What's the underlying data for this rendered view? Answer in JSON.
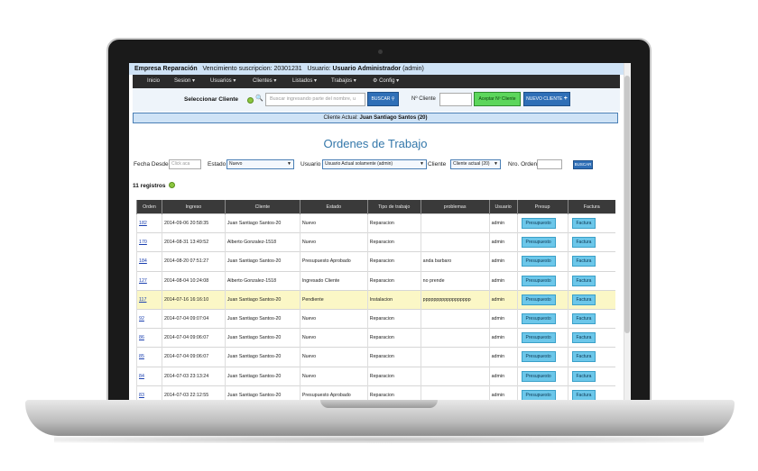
{
  "topbar": {
    "company": "Empresa Reparación",
    "expiry": "Vencimiento suscripcion: 20301231",
    "user_label": "Usuario:",
    "user": "Usuario Administrador",
    "role": "(admin)"
  },
  "nav": {
    "items": [
      {
        "label": "Inicio"
      },
      {
        "label": "Sesion"
      },
      {
        "label": "Usuarios"
      },
      {
        "label": "Clientes"
      },
      {
        "label": "Listados"
      },
      {
        "label": "Trabajos"
      },
      {
        "label": "Config"
      }
    ],
    "caret": "▾"
  },
  "client_select": {
    "label": "Seleccionar Cliente",
    "search_placeholder": "Buscar ingresando parte del nombre, u",
    "search_button": "BUSCAR",
    "ncliente_label": "Nº Cliente",
    "accept_button": "Aceptar Nº Cliente",
    "new_button": "NUEVO CLIENTE"
  },
  "current_client": {
    "label": "Cliente Actual:",
    "name": "Juan Santiago Santos (20)"
  },
  "page_title": "Ordenes de Trabajo",
  "filters": {
    "fecha_label": "Fecha Desde",
    "fecha_placeholder": "Click aca",
    "estado_label": "Estado",
    "estado_value": "Nuevo",
    "usuario_label": "Usuario",
    "usuario_value": "Usuario Actual solamente (admin)",
    "cliente_label": "Cliente",
    "cliente_value": "Cliente actual (20)",
    "nro_label": "Nro. Orden",
    "buscar_button": "BUSCAR"
  },
  "registros": "11 registros",
  "table": {
    "headers": [
      "Orden",
      "Ingreso",
      "Cliente",
      "Estado",
      "Tipo de trabajo",
      "problemas",
      "Usuario",
      "Presup",
      "Factura"
    ],
    "presup_label": "Presupuesto",
    "factura_label": "Factura",
    "rows": [
      {
        "orden": "182",
        "ingreso": "2014-09-06 20:58:35",
        "cliente": "Juan Santiago Santos-20",
        "estado": "Nuevo",
        "tipo": "Reparacion",
        "problemas": "",
        "usuario": "admin"
      },
      {
        "orden": "170",
        "ingreso": "2014-08-31 13:49:52",
        "cliente": "Alberto Gonzalez-1518",
        "estado": "Nuevo",
        "tipo": "Reparacion",
        "problemas": "",
        "usuario": "admin"
      },
      {
        "orden": "184",
        "ingreso": "2014-08-20 07:51:27",
        "cliente": "Juan Santiago Santos-20",
        "estado": "Presupuesto Aprobado",
        "tipo": "Reparacion",
        "problemas": "anda barbaro",
        "usuario": "admin"
      },
      {
        "orden": "127",
        "ingreso": "2014-08-04 10:24:08",
        "cliente": "Alberto Gonzalez-1518",
        "estado": "Ingresado Cliente",
        "tipo": "Reparacion",
        "problemas": "no prende",
        "usuario": "admin"
      },
      {
        "orden": "117",
        "ingreso": "2014-07-16 16:16:10",
        "cliente": "Juan Santiago Santos-20",
        "estado": "Pendiente",
        "tipo": "Instalacion",
        "problemas": "pppppppppppppppppp",
        "usuario": "admin"
      },
      {
        "orden": "92",
        "ingreso": "2014-07-04 09:07:04",
        "cliente": "Juan Santiago Santos-20",
        "estado": "Nuevo",
        "tipo": "Reparacion",
        "problemas": "",
        "usuario": "admin"
      },
      {
        "orden": "86",
        "ingreso": "2014-07-04 09:06:07",
        "cliente": "Juan Santiago Santos-20",
        "estado": "Nuevo",
        "tipo": "Reparacion",
        "problemas": "",
        "usuario": "admin"
      },
      {
        "orden": "85",
        "ingreso": "2014-07-04 09:06:07",
        "cliente": "Juan Santiago Santos-20",
        "estado": "Nuevo",
        "tipo": "Reparacion",
        "problemas": "",
        "usuario": "admin"
      },
      {
        "orden": "84",
        "ingreso": "2014-07-03 23:13:24",
        "cliente": "Juan Santiago Santos-20",
        "estado": "Nuevo",
        "tipo": "Reparacion",
        "problemas": "",
        "usuario": "admin"
      },
      {
        "orden": "83",
        "ingreso": "2014-07-03 22:12:55",
        "cliente": "Juan Santiago Santos-20",
        "estado": "Presupuesto Aprobado",
        "tipo": "Reparacion",
        "problemas": "",
        "usuario": "admin"
      }
    ],
    "highlight_row": "117"
  }
}
